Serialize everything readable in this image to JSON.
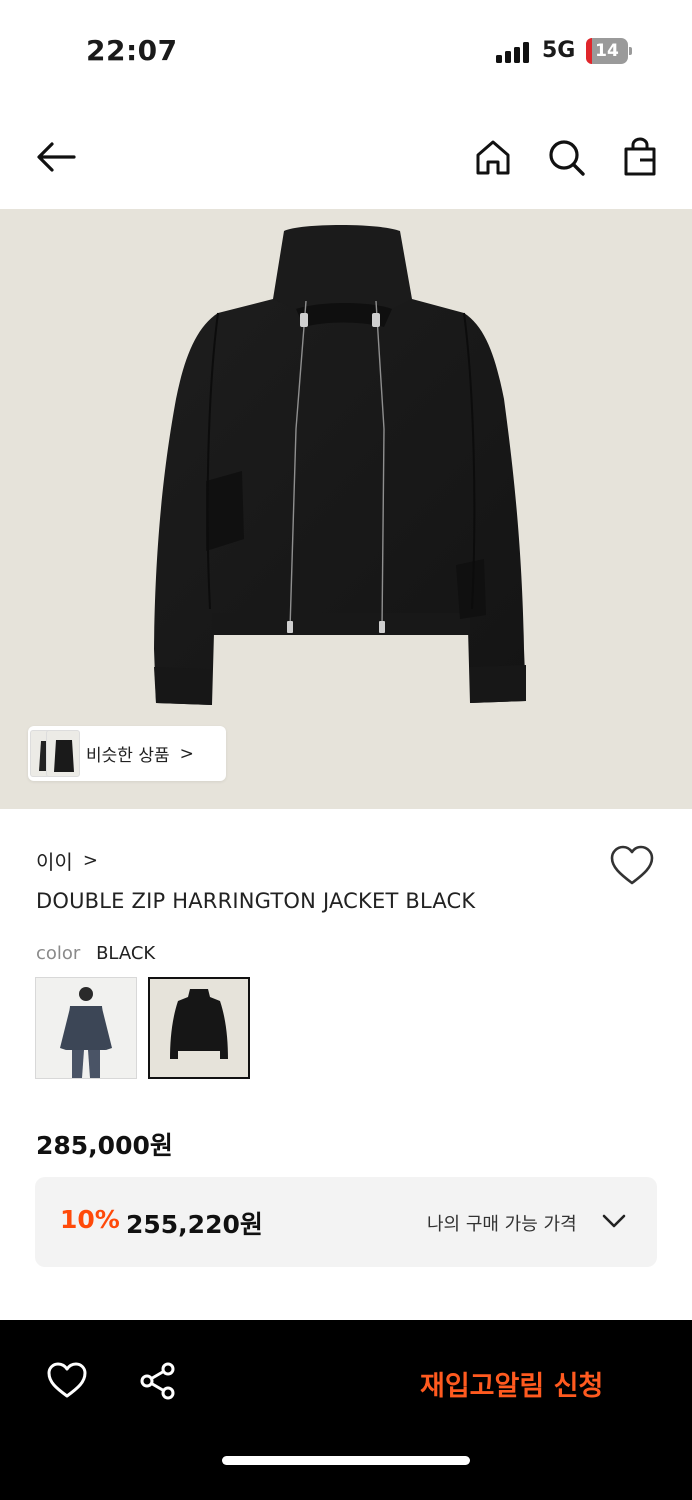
{
  "status_bar": {
    "time": "22:07",
    "network": "5G",
    "battery": "14",
    "battery_level": 0.14,
    "signal_icon": "cellular-signal-icon",
    "battery_icon": "battery-icon"
  },
  "nav": {
    "back_icon": "arrow-left-icon",
    "home_icon": "home-icon",
    "search_icon": "search-icon",
    "bag_icon": "shopping-bag-icon"
  },
  "hero": {
    "image": "black-double-zip-harrington-jacket",
    "similar_label": "비슷한 상품",
    "similar_arrow": ">"
  },
  "product": {
    "brand": "이이",
    "brand_arrow": ">",
    "title": "DOUBLE ZIP HARRINGTON JACKET BLACK",
    "color_label": "color",
    "color_value": "BLACK",
    "swatches": [
      {
        "name": "navy-model-photo",
        "selected": false
      },
      {
        "name": "black-jacket-photo",
        "selected": true
      }
    ],
    "original_price": "285,000원",
    "discount": "10%",
    "sale_price": "255,220원",
    "my_price_label": "나의 구매 가능 가격"
  },
  "bottom_bar": {
    "wishlist_icon": "heart-icon",
    "share_icon": "share-icon",
    "restock_label": "재입고알림 신청",
    "accent": "#ff5a1f"
  },
  "colors": {
    "discount_accent": "#ff4a0a",
    "hero_background": "#e6e3da"
  }
}
